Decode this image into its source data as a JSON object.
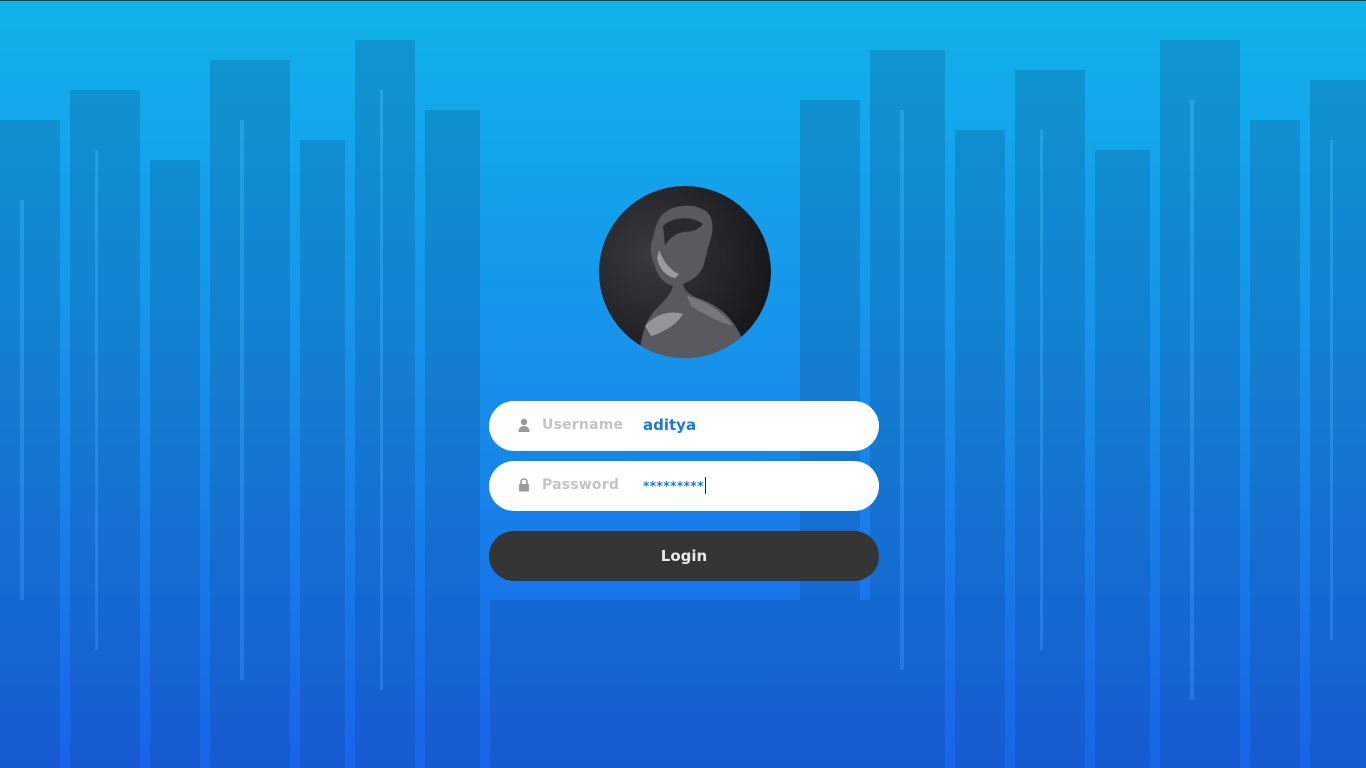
{
  "login_form": {
    "username_label": "Username",
    "username_value": "aditya",
    "password_label": "Password",
    "password_value": "*********",
    "login_label": "Login"
  },
  "icons": {
    "username": "user-icon",
    "password": "lock-icon"
  },
  "colors": {
    "background_top": "#10b2ea",
    "background_bottom": "#1a63ea",
    "field_background": "#ffffff",
    "label_text": "#c4c4c4",
    "value_text": "#1a78d6",
    "button_background": "#353535",
    "button_text": "#e9e9e9"
  }
}
